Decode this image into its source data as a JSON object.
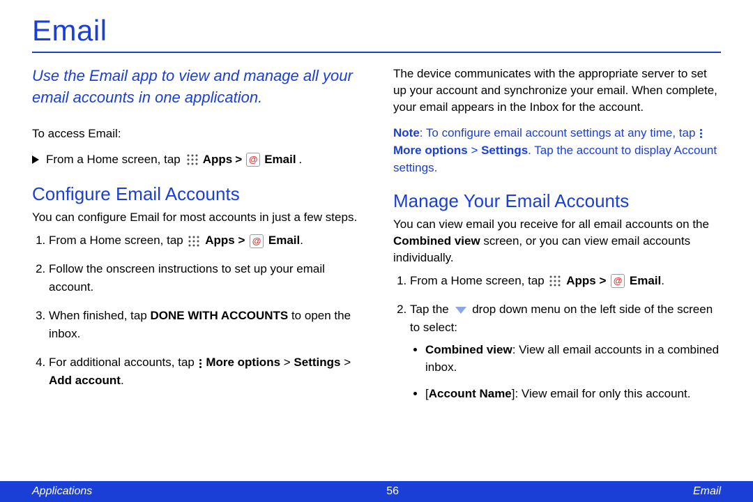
{
  "page": {
    "title": "Email",
    "intro": "Use the Email app to view and manage all your email accounts in one application.",
    "access_label": "To access Email:",
    "access_step_pre": "From a Home screen, tap",
    "apps_label": "Apps",
    "gt": ">",
    "email_label": "Email",
    "period": "."
  },
  "configure": {
    "heading": "Configure Email Accounts",
    "lead": "You can configure Email for most accounts in just a few steps.",
    "steps": {
      "s1_pre": "From a Home screen, tap",
      "s2": "Follow the onscreen instructions to set up your email account.",
      "s3_pre": "When finished, tap ",
      "s3_bold": "DONE WITH ACCOUNTS",
      "s3_post": " to open the inbox.",
      "s4_pre": "For additional accounts, tap ",
      "s4_bold1": "More options",
      "s4_mid": " > ",
      "s4_bold2": "Settings",
      "s4_mid2": " > ",
      "s4_bold3": "Add account",
      "s4_post": "."
    }
  },
  "right": {
    "p1": "The device communicates with the appropriate server to set up your account and synchronize your email. When complete, your email appears in the Inbox for the account.",
    "note_label": "Note",
    "note_pre": ": To configure email account settings at any time, tap ",
    "note_bold1": "More options",
    "note_mid": " > ",
    "note_bold2": "Settings",
    "note_post": ". Tap the account to display Account settings."
  },
  "manage": {
    "heading": "Manage Your Email Accounts",
    "lead_pre": "You can view email you receive for all email accounts on the ",
    "lead_bold": "Combined view",
    "lead_post": " screen, or you can view email accounts individually.",
    "s1_pre": "From a Home screen, tap",
    "s2_pre": "Tap the ",
    "s2_post": " drop down menu on the left side of the screen to select:",
    "b1_bold": "Combined view",
    "b1_post": ": View all email accounts in a combined inbox.",
    "b2_pre": "[",
    "b2_bold": "Account Name",
    "b2_post": "]: View email for only this account."
  },
  "footer": {
    "left": "Applications",
    "page": "56",
    "right": "Email"
  }
}
